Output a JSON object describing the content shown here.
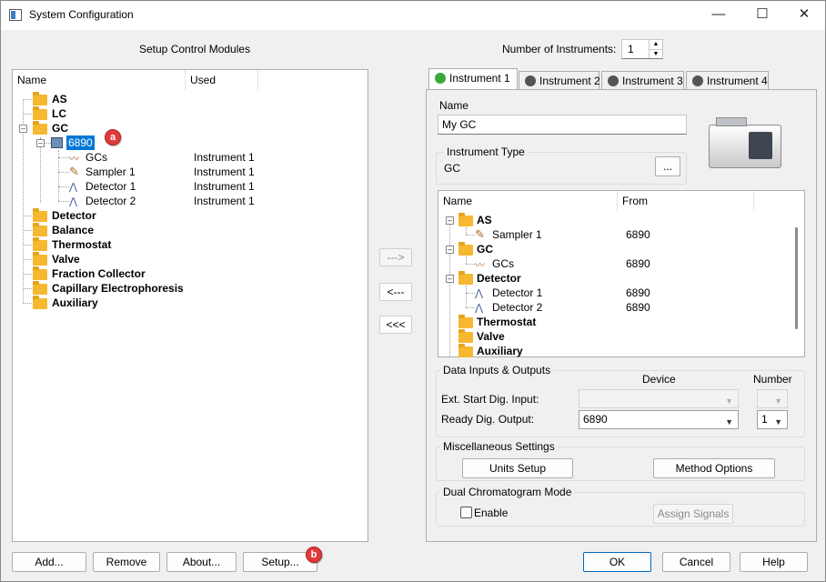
{
  "window": {
    "title": "System Configuration",
    "minimize": "—",
    "maximize": "☐",
    "close": "✕"
  },
  "left": {
    "title": "Setup Control Modules",
    "columns": [
      "Name",
      "Used"
    ],
    "tree": {
      "as": "AS",
      "lc": "LC",
      "gc": "GC",
      "gc_child": "6890",
      "gc_sub": [
        {
          "name": "GCs",
          "used": "Instrument 1"
        },
        {
          "name": "Sampler 1",
          "used": "Instrument 1"
        },
        {
          "name": "Detector 1",
          "used": "Instrument 1"
        },
        {
          "name": "Detector 2",
          "used": "Instrument 1"
        }
      ],
      "detector": "Detector",
      "balance": "Balance",
      "thermostat": "Thermostat",
      "valve": "Valve",
      "fraction": "Fraction Collector",
      "capillary": "Capillary Electrophoresis",
      "auxiliary": "Auxiliary"
    },
    "buttons": {
      "add": "Add...",
      "remove": "Remove",
      "about": "About...",
      "setup": "Setup..."
    }
  },
  "annotations": {
    "a": "a",
    "b": "b"
  },
  "arrows": {
    "right": "--->",
    "left": "<---",
    "left_all": "<<<"
  },
  "instruments": {
    "label": "Number of Instruments:",
    "count": "1",
    "tabs": [
      "Instrument 1",
      "Instrument 2",
      "Instrument 3",
      "Instrument 4"
    ],
    "colors": {
      "active_tab_icon": "#3aa83a",
      "inactive_tab_icon": "#555555",
      "highlight": "#0078d7"
    }
  },
  "detail": {
    "name_label": "Name",
    "name_value": "My GC",
    "type_group": "Instrument Type",
    "type_value": "GC",
    "type_button": "...",
    "columns": [
      "Name",
      "From"
    ],
    "tree": {
      "as": "AS",
      "sampler": "Sampler 1",
      "sampler_from": "6890",
      "gc": "GC",
      "gcs": "GCs",
      "gcs_from": "6890",
      "detector": "Detector",
      "det1": "Detector 1",
      "det1_from": "6890",
      "det2": "Detector 2",
      "det2_from": "6890",
      "thermostat": "Thermostat",
      "valve": "Valve",
      "auxiliary": "Auxiliary"
    },
    "io": {
      "group": "Data Inputs & Outputs",
      "device_col": "Device",
      "number_col": "Number",
      "ext_label": "Ext. Start Dig. Input:",
      "ready_label": "Ready Dig. Output:",
      "ready_device": "6890",
      "ready_number": "1"
    },
    "misc": {
      "group": "Miscellaneous Settings",
      "units": "Units Setup",
      "method": "Method Options"
    },
    "dual": {
      "group": "Dual Chromatogram Mode",
      "enable": "Enable",
      "assign": "Assign Signals"
    }
  },
  "footer": {
    "ok": "OK",
    "cancel": "Cancel",
    "help": "Help"
  }
}
